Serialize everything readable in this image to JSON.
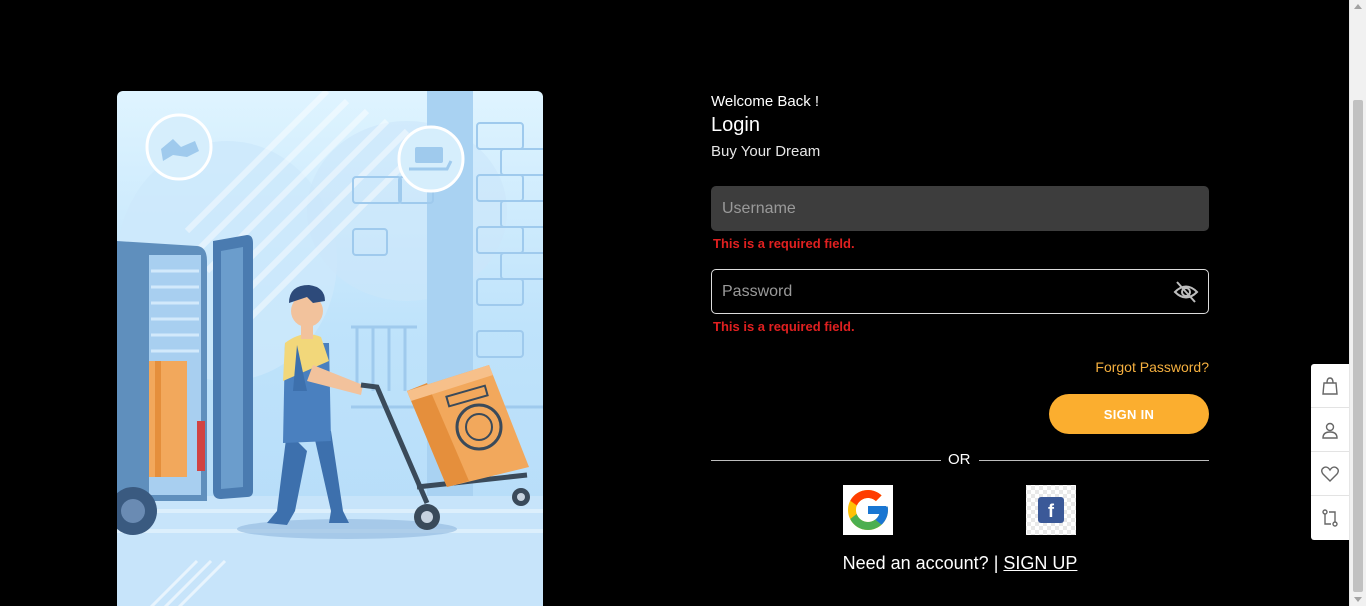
{
  "header": {
    "welcome": "Welcome Back !",
    "title": "Login",
    "subtitle": "Buy Your Dream"
  },
  "form": {
    "username_placeholder": "Username",
    "username_error": "This is a required field.",
    "password_placeholder": "Password",
    "password_error": "This is a required field.",
    "forgot_password": "Forgot Password?",
    "signin_label": "SIGN IN",
    "or_label": "OR"
  },
  "social": {
    "google": "google-icon",
    "facebook": "facebook-icon",
    "facebook_letter": "f"
  },
  "signup": {
    "prompt": "Need an account?",
    "separator": "|",
    "link": "SIGN UP"
  },
  "side_widget": [
    "bag-icon",
    "user-icon",
    "heart-icon",
    "compare-icon"
  ],
  "colors": {
    "accent": "#fbae2f",
    "error": "#e02020",
    "forgot": "#f5b03f",
    "input_bg": "#3d3d3d"
  }
}
